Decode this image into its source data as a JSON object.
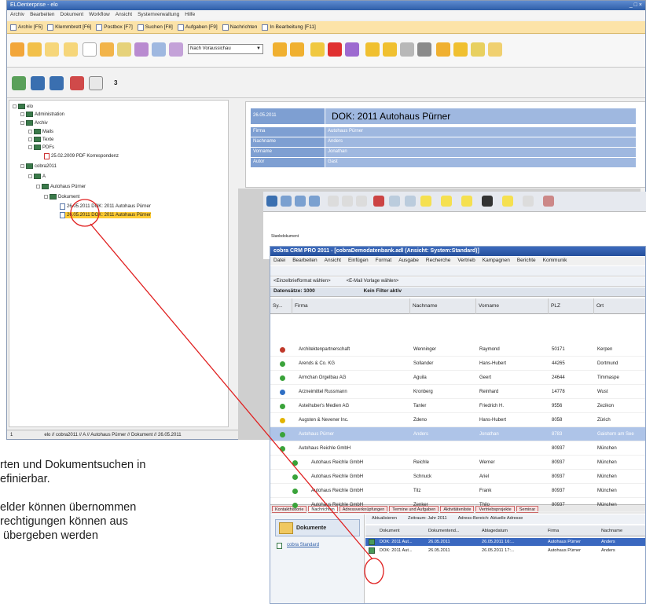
{
  "elo": {
    "title": "ELOenterprise - elo",
    "menu": [
      "Archiv",
      "Bearbeiten",
      "Dokument",
      "Workflow",
      "Ansicht",
      "Systemverwaltung",
      "Hilfe"
    ],
    "tabs": [
      "Archiv [F5]",
      "Klemmbrett [F6]",
      "Postbox [F7]",
      "Suchen [F8]",
      "Aufgaben [F9]",
      "Nachrichten",
      "In Bearbeitung [F11]"
    ],
    "view_select": "Nach Voraussichau",
    "tree": [
      "elo",
      "Administration",
      "Archiv",
      "Mails",
      "Texte",
      "PDFs",
      "25.02.2009 PDF Korrespondenz",
      "cobra2011",
      "A",
      "Autohaus Pürner",
      "Dokument",
      "26.05.2011 DOK: 2011 Autohaus Pürner",
      "26.05.2011 DOK: 2011 Autohaus Pürner"
    ],
    "status_num": "1",
    "status_path": "elo // cobra2011 // A // Autohaus Pürner // Dokument // 26.05.2011",
    "meta": {
      "date": "26.05.2011",
      "headline": "DOK: 2011 Autohaus Pürner",
      "fields": [
        {
          "k": "Firma",
          "v": "Autohaus Pürner"
        },
        {
          "k": "Nachname",
          "v": "Anders"
        },
        {
          "k": "Vorname",
          "v": "Jonathan"
        },
        {
          "k": "Autor",
          "v": "Gast"
        }
      ]
    },
    "preview_label": "Stanbdokument"
  },
  "cobra": {
    "title": "cobra CRM PRO 2011 - [cobraDemodatenbank.adl (Ansicht: System:Standard)]",
    "menu": [
      "Datei",
      "Bearbeiten",
      "Ansicht",
      "Einfügen",
      "Format",
      "Ausgabe",
      "Recherche",
      "Vertrieb",
      "Kampagnen",
      "Berichte",
      "Kommunik"
    ],
    "tb2a": "<Einzelbriefformat wählen>",
    "tb2b": "<E-Mail Vorlage wählen>",
    "tb3": "Datensätze: 1000",
    "tb3b": "Kein Filter aktiv",
    "cols": [
      "Sy...",
      "Firma",
      "Nachname",
      "Vorname",
      "PLZ",
      "Ort"
    ],
    "rows": [
      {
        "c": "#c0392b",
        "firma": "Architektenpartnerschaft",
        "nach": "Wenninger",
        "vor": "Raymond",
        "plz": "50171",
        "ort": "Kerpen"
      },
      {
        "c": "#3aa33a",
        "firma": "Arends & Co. KG",
        "nach": "Sollander",
        "vor": "Hans-Hubert",
        "plz": "44265",
        "ort": "Dortmund"
      },
      {
        "c": "#3aa33a",
        "firma": "Armchan Orgelbau AG",
        "nach": "Aguila",
        "vor": "Geert",
        "plz": "24644",
        "ort": "Timmaspe"
      },
      {
        "c": "#2f6fc4",
        "firma": "Arzneimittel Russmann",
        "nach": "Kronberg",
        "vor": "Reinhard",
        "plz": "14778",
        "ort": "Wust"
      },
      {
        "c": "#3aa33a",
        "firma": "Asteihuber's Medien AG",
        "nach": "Tanler",
        "vor": "Friedrich H.",
        "plz": "9556",
        "ort": "Zezikon"
      },
      {
        "c": "#e2b400",
        "firma": "Augsten & Nevener Inc.",
        "nach": "Zdeno",
        "vor": "Hans-Hubert",
        "plz": "8058",
        "ort": "Zürich"
      },
      {
        "c": "#3aa33a",
        "firma": "Autohaus Pürner",
        "nach": "Anders",
        "vor": "Jonathan",
        "plz": "8783",
        "ort": "Gaishorn am See",
        "sel": true
      },
      {
        "c": "#3aa33a",
        "firma": "Autohaus Reichle GmbH",
        "nach": "",
        "vor": "",
        "plz": "80937",
        "ort": "München"
      },
      {
        "c": "#3aa33a",
        "firma": "Autohaus Reichle GmbH",
        "nach": "Reichle",
        "vor": "Werner",
        "plz": "80937",
        "ort": "München",
        "ind": true
      },
      {
        "c": "#3aa33a",
        "firma": "Autohaus Reichle GmbH",
        "nach": "Schnuck",
        "vor": "Ariel",
        "plz": "80937",
        "ort": "München",
        "ind": true
      },
      {
        "c": "#3aa33a",
        "firma": "Autohaus Reichle GmbH",
        "nach": "Titz",
        "vor": "Frank",
        "plz": "80937",
        "ort": "München",
        "ind": true
      },
      {
        "c": "#3aa33a",
        "firma": "Autohaus Reichle GmbH",
        "nach": "Zenker",
        "vor": "Thilo",
        "plz": "80937",
        "ort": "München",
        "ind": true
      }
    ],
    "bottom_tabs": [
      "Kontakthistorie",
      "Nachrichten",
      "Adressverknüpfungen",
      "Termine und Aufgaben",
      "Aktivitätenliste",
      "Vertriebsprojekte",
      "Seminar"
    ],
    "side_title": "Dokumente",
    "side_item": "cobra Standard",
    "sub_toolbar": [
      "Aktualisieren",
      "Zeitraum: Jahr 2011",
      "Adress-Bereich: Aktuelle Adresse"
    ],
    "sub_cols": [
      "Dokument",
      "Dokumentend...",
      "Ablagedatum",
      "Firma",
      "Nachname"
    ],
    "sub_rows": [
      {
        "doc": "DOK: 2011 Aut...",
        "d1": "26.05.2011",
        "d2": "26.05.2011 16:...",
        "firma": "Autohaus Pürner",
        "nach": "Anders",
        "sel": true
      },
      {
        "doc": "DOK: 2011 Aut...",
        "d1": "26.05.2011",
        "d2": "26.05.2011 17:...",
        "firma": "Autohaus Pürner",
        "nach": "Anders"
      }
    ]
  },
  "text": [
    "rten und Dokumentsuchen in",
    "efinierbar.",
    "elder können übernommen",
    "rechtigungen können aus",
    "übergeben werden"
  ],
  "accent": "#e02020"
}
